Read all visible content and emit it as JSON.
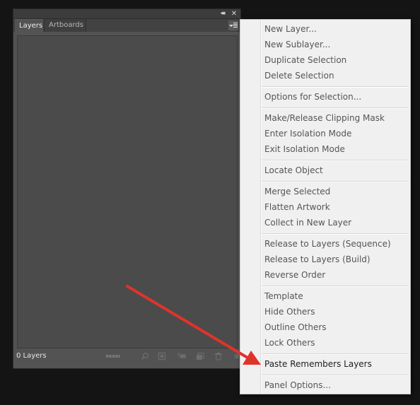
{
  "panel": {
    "collapse_glyph": "◂◂",
    "close_glyph": "✕",
    "tabs": [
      {
        "label": "Layers",
        "active": true
      },
      {
        "label": "Artboards",
        "active": false
      }
    ],
    "layer_count": "0 Layers",
    "footer_icons": [
      "search-icon",
      "clipping-mask-icon",
      "new-sublayer-icon",
      "new-layer-icon",
      "trash-icon"
    ]
  },
  "menu": {
    "items": [
      "New Layer...",
      "New Sublayer...",
      "Duplicate Selection",
      "Delete Selection",
      "Options for Selection...",
      "Make/Release Clipping Mask",
      "Enter Isolation Mode",
      "Exit Isolation Mode",
      "Locate Object",
      "Merge Selected",
      "Flatten Artwork",
      "Collect in New Layer",
      "Release to Layers (Sequence)",
      "Release to Layers (Build)",
      "Reverse Order",
      "Template",
      "Hide Others",
      "Outline Others",
      "Lock Others",
      "Paste Remembers Layers",
      "Panel Options..."
    ],
    "highlighted_item": "Paste Remembers Layers"
  },
  "colors": {
    "background": "#141414",
    "panel": "#535353",
    "menu": "#f0f0f0",
    "annotation_arrow": "#e0332b"
  }
}
